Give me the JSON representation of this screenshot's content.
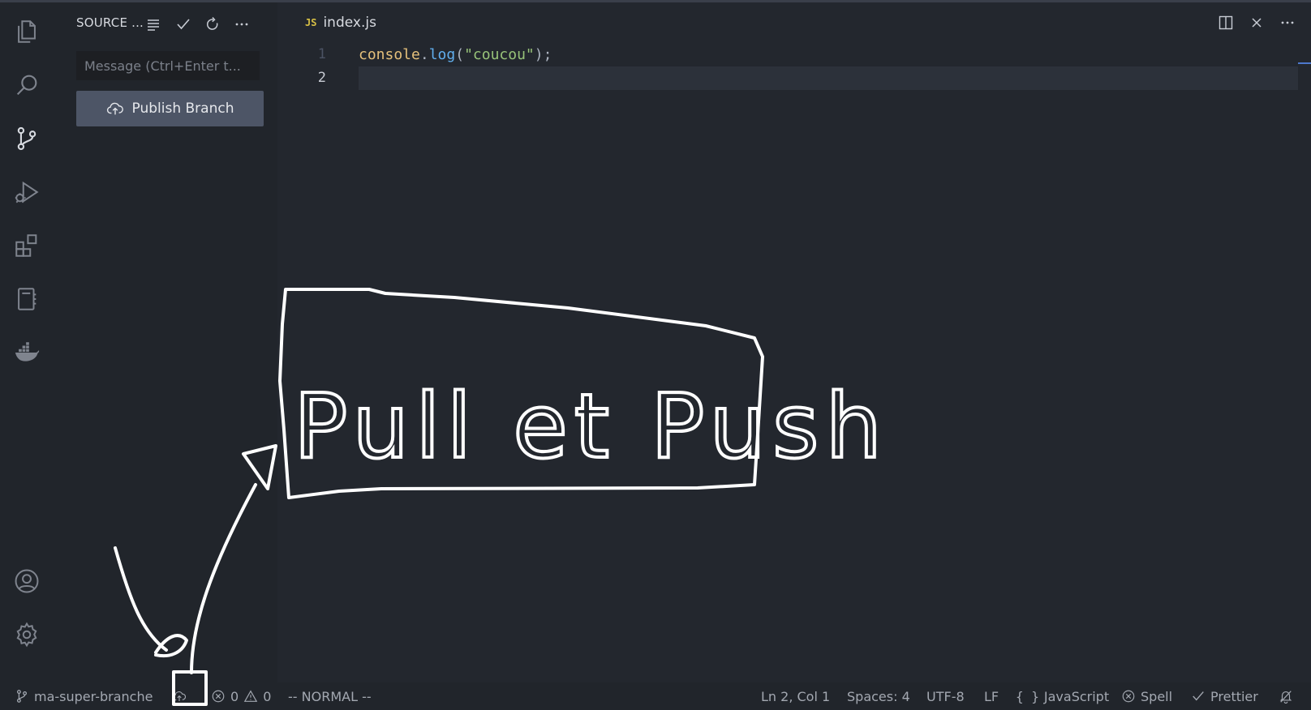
{
  "sidebar": {
    "title": "SOURCE ...",
    "message_placeholder": "Message (Ctrl+Enter t...",
    "publish_label": "Publish Branch"
  },
  "editor": {
    "tab": {
      "badge": "JS",
      "label": "index.js"
    },
    "line_numbers": [
      "1",
      "2"
    ],
    "code": {
      "obj": "console",
      "dot": ".",
      "fn": "log",
      "open": "(",
      "str": "\"coucou\"",
      "close": ");"
    }
  },
  "status": {
    "branch": "ma-super-branche",
    "errors": "0",
    "warnings": "0",
    "mode": "-- NORMAL --",
    "position": "Ln 2, Col 1",
    "spaces": "Spaces: 4",
    "encoding": "UTF-8",
    "eol": "LF",
    "language": "JavaScript",
    "spell": "Spell",
    "prettier": "Prettier"
  },
  "annotation": {
    "text": "Pull et Push"
  },
  "icons": {
    "activity": [
      "explorer-icon",
      "search-icon",
      "source-control-icon",
      "run-debug-icon",
      "extensions-icon",
      "notebook-icon",
      "docker-icon",
      "account-icon",
      "settings-gear-icon"
    ]
  },
  "colors": {
    "accent": "#4d78cc",
    "string": "#98c379",
    "function": "#61afef",
    "object": "#e5c07b"
  }
}
